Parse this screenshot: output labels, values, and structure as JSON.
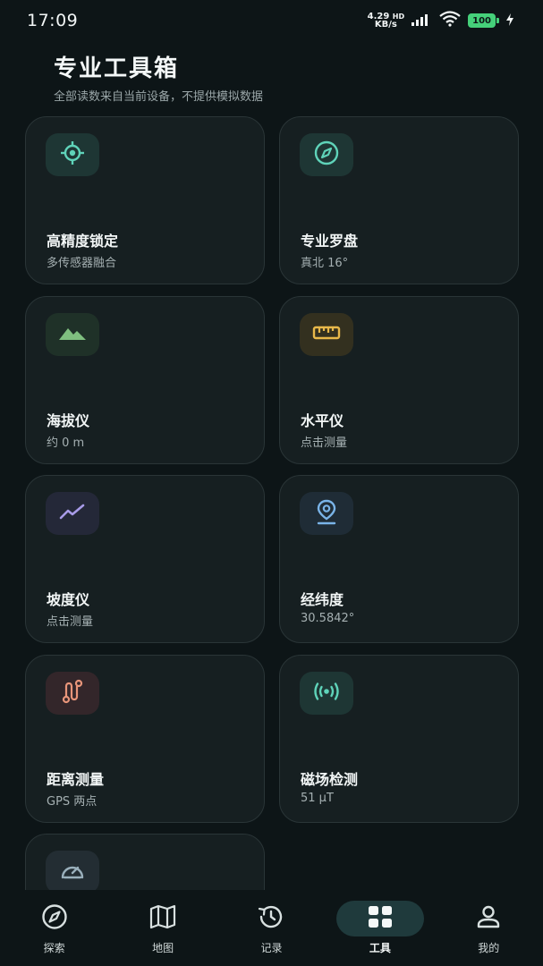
{
  "status_bar": {
    "time": "17:09",
    "net_speed": "4.29",
    "net_unit": "KB/s",
    "net_type": "HD",
    "battery": "100"
  },
  "header": {
    "title": "专业工具箱",
    "subtitle": "全部读数来自当前设备，不提供模拟数据"
  },
  "tools": [
    {
      "name": "高精度锁定",
      "sub": "多传感器融合",
      "icon": "crosshair-icon",
      "color": "#5fd3b9",
      "bg": "#1e3634"
    },
    {
      "name": "专业罗盘",
      "sub": "真北 16°",
      "icon": "compass-icon",
      "color": "#5fd3b9",
      "bg": "#1e3634"
    },
    {
      "name": "海拔仪",
      "sub": "约 0 m",
      "icon": "mountain-icon",
      "color": "#7fbf7f",
      "bg": "#1f3128"
    },
    {
      "name": "水平仪",
      "sub": "点击测量",
      "icon": "ruler-icon",
      "color": "#e8b84a",
      "bg": "#33301f"
    },
    {
      "name": "坡度仪",
      "sub": "点击测量",
      "icon": "trend-icon",
      "color": "#a89be8",
      "bg": "#242838"
    },
    {
      "name": "经纬度",
      "sub": "30.5842°",
      "icon": "location-pin-icon",
      "color": "#7ab4e8",
      "bg": "#1f2c36"
    },
    {
      "name": "距离测量",
      "sub": "GPS 两点",
      "icon": "route-icon",
      "color": "#e8957a",
      "bg": "#33262a"
    },
    {
      "name": "磁场检测",
      "sub": "51 μT",
      "icon": "signal-icon",
      "color": "#5fd3b9",
      "bg": "#1e3634"
    },
    {
      "name": "",
      "sub": "",
      "icon": "speedometer-icon",
      "color": "#9ab0bc",
      "bg": "#232d33"
    }
  ],
  "nav": [
    {
      "label": "探索",
      "icon": "compass-nav-icon",
      "active": false
    },
    {
      "label": "地图",
      "icon": "map-icon",
      "active": false
    },
    {
      "label": "记录",
      "icon": "history-icon",
      "active": false
    },
    {
      "label": "工具",
      "icon": "grid-icon",
      "active": true
    },
    {
      "label": "我的",
      "icon": "user-icon",
      "active": false
    }
  ]
}
